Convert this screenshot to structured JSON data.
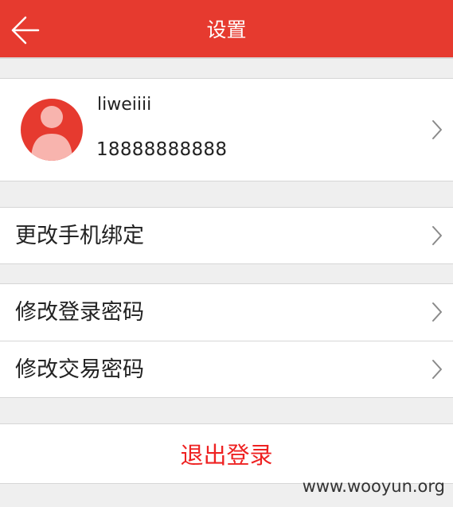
{
  "header": {
    "title": "设置",
    "back_icon": "back-arrow-icon",
    "background": "#e63a2f"
  },
  "profile": {
    "username": "liweiiii",
    "phone": "18888888888",
    "avatar_icon": "user-avatar-icon",
    "avatar_color": "#e63a2f"
  },
  "menu": {
    "change_phone": "更改手机绑定",
    "change_login_password": "修改登录密码",
    "change_trade_password": "修改交易密码"
  },
  "logout": {
    "label": "退出登录",
    "color": "#ee2222"
  },
  "watermark": "www.wooyun.org"
}
